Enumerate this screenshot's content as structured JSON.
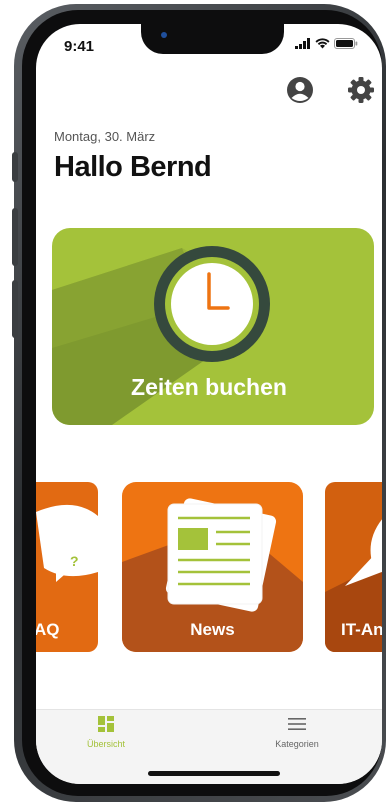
{
  "status_bar": {
    "time": "9:41"
  },
  "header": {
    "date": "Montag, 30. März",
    "greeting": "Hallo Bernd"
  },
  "hero": {
    "label": "Zeiten buchen"
  },
  "tiles": [
    {
      "label": "AQ"
    },
    {
      "label": "News"
    },
    {
      "label": "IT-An"
    }
  ],
  "bottom_nav": {
    "overview_label": "Übersicht",
    "categories_label": "Kategorien"
  },
  "colors": {
    "accent": "#a4c23a",
    "tile_orange": "#ee7412",
    "nav_active": "#a4c23a"
  },
  "icons": [
    "profile-icon",
    "settings-gear-icon",
    "clock-icon",
    "newspaper-icon",
    "grid-icon",
    "menu-icon"
  ]
}
